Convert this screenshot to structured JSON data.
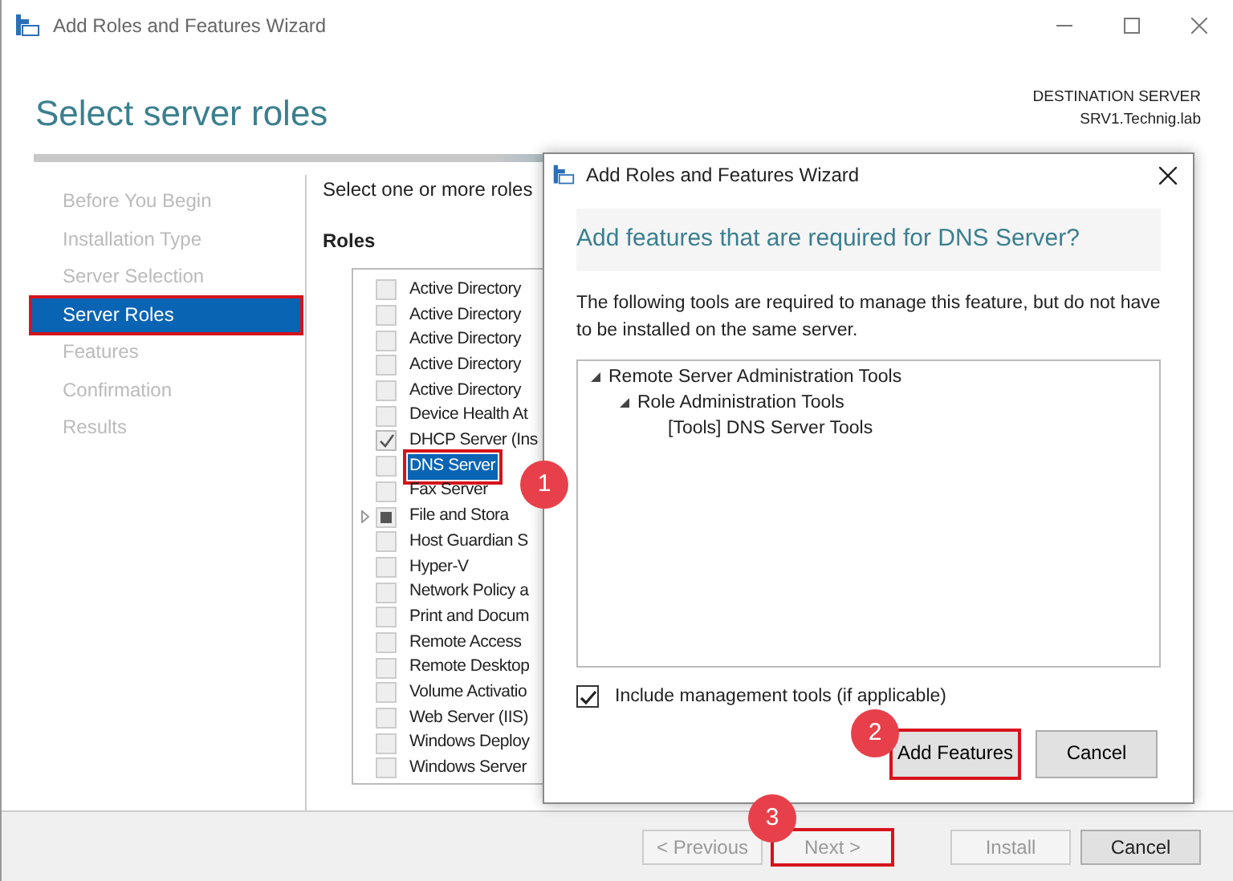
{
  "window": {
    "title": "Add Roles and Features Wizard"
  },
  "header": {
    "title": "Select server roles",
    "destination_label": "DESTINATION SERVER",
    "destination_server": "SRV1.Technig.lab"
  },
  "steps": [
    {
      "label": "Before You Begin",
      "selected": false,
      "annotated": false
    },
    {
      "label": "Installation Type",
      "selected": false,
      "annotated": false
    },
    {
      "label": "Server Selection",
      "selected": false,
      "annotated": false
    },
    {
      "label": "Server Roles",
      "selected": true,
      "annotated": true
    },
    {
      "label": "Features",
      "selected": false,
      "annotated": false
    },
    {
      "label": "Confirmation",
      "selected": false,
      "annotated": false
    },
    {
      "label": "Results",
      "selected": false,
      "annotated": false
    }
  ],
  "content": {
    "intro": "Select one or more roles",
    "roles_label": "Roles"
  },
  "roles": [
    {
      "label": "Active Directory",
      "checked": false,
      "indeterminate": false,
      "expandable": false,
      "selected": false,
      "annotated": false
    },
    {
      "label": "Active Directory",
      "checked": false,
      "indeterminate": false,
      "expandable": false,
      "selected": false,
      "annotated": false
    },
    {
      "label": "Active Directory",
      "checked": false,
      "indeterminate": false,
      "expandable": false,
      "selected": false,
      "annotated": false
    },
    {
      "label": "Active Directory",
      "checked": false,
      "indeterminate": false,
      "expandable": false,
      "selected": false,
      "annotated": false
    },
    {
      "label": "Active Directory",
      "checked": false,
      "indeterminate": false,
      "expandable": false,
      "selected": false,
      "annotated": false
    },
    {
      "label": "Device Health At",
      "checked": false,
      "indeterminate": false,
      "expandable": false,
      "selected": false,
      "annotated": false
    },
    {
      "label": "DHCP Server (Ins",
      "checked": true,
      "indeterminate": false,
      "expandable": false,
      "selected": false,
      "annotated": false
    },
    {
      "label": "DNS Server",
      "checked": false,
      "indeterminate": false,
      "expandable": false,
      "selected": true,
      "annotated": true
    },
    {
      "label": "Fax Server",
      "checked": false,
      "indeterminate": false,
      "expandable": false,
      "selected": false,
      "annotated": false
    },
    {
      "label": "File and Stora",
      "checked": false,
      "indeterminate": true,
      "expandable": true,
      "selected": false,
      "annotated": false
    },
    {
      "label": "Host Guardian S",
      "checked": false,
      "indeterminate": false,
      "expandable": false,
      "selected": false,
      "annotated": false
    },
    {
      "label": "Hyper-V",
      "checked": false,
      "indeterminate": false,
      "expandable": false,
      "selected": false,
      "annotated": false
    },
    {
      "label": "Network Policy a",
      "checked": false,
      "indeterminate": false,
      "expandable": false,
      "selected": false,
      "annotated": false
    },
    {
      "label": "Print and Docum",
      "checked": false,
      "indeterminate": false,
      "expandable": false,
      "selected": false,
      "annotated": false
    },
    {
      "label": "Remote Access",
      "checked": false,
      "indeterminate": false,
      "expandable": false,
      "selected": false,
      "annotated": false
    },
    {
      "label": "Remote Desktop",
      "checked": false,
      "indeterminate": false,
      "expandable": false,
      "selected": false,
      "annotated": false
    },
    {
      "label": "Volume Activatio",
      "checked": false,
      "indeterminate": false,
      "expandable": false,
      "selected": false,
      "annotated": false
    },
    {
      "label": "Web Server (IIS)",
      "checked": false,
      "indeterminate": false,
      "expandable": false,
      "selected": false,
      "annotated": false
    },
    {
      "label": "Windows Deploy",
      "checked": false,
      "indeterminate": false,
      "expandable": false,
      "selected": false,
      "annotated": false
    },
    {
      "label": "Windows Server",
      "checked": false,
      "indeterminate": false,
      "expandable": false,
      "selected": false,
      "annotated": false
    }
  ],
  "footer_buttons": [
    {
      "label": "< Previous",
      "disabled": true,
      "annotated": false
    },
    {
      "label": "Next >",
      "disabled": true,
      "annotated": true
    },
    {
      "label": "Install",
      "disabled": true,
      "annotated": false
    },
    {
      "label": "Cancel",
      "disabled": false,
      "annotated": false
    }
  ],
  "dialog": {
    "title": "Add Roles and Features Wizard",
    "heading": "Add features that are required for DNS Server?",
    "description": "The following tools are required to manage this feature, but do not have to be installed on the same server.",
    "tree": [
      {
        "label": "Remote Server Administration Tools",
        "expanded": true,
        "children": [
          {
            "label": "Role Administration Tools",
            "expanded": true,
            "children": [
              {
                "label": "[Tools] DNS Server Tools"
              }
            ]
          }
        ]
      }
    ],
    "include_tools": {
      "label": "Include management tools (if applicable)",
      "checked": true
    },
    "buttons": [
      {
        "label": "Add Features",
        "annotated": true
      },
      {
        "label": "Cancel",
        "annotated": false
      }
    ]
  },
  "callouts": [
    {
      "label": "1"
    },
    {
      "label": "2"
    },
    {
      "label": "3"
    }
  ]
}
